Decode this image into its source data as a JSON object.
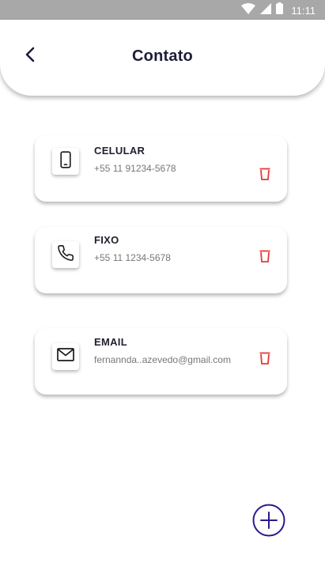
{
  "status_bar": {
    "time": "11:11",
    "icons": [
      "wifi-icon",
      "signal-icon",
      "battery-icon"
    ]
  },
  "header": {
    "title": "Contato",
    "back_icon": "chevron-left-icon"
  },
  "contacts": [
    {
      "label": "CELULAR",
      "value": "+55 11 91234-5678",
      "icon": "smartphone-icon",
      "delete_icon": "trash-icon"
    },
    {
      "label": "FIXO",
      "value": "+55 11 1234-5678",
      "icon": "phone-icon",
      "delete_icon": "trash-icon"
    },
    {
      "label": "EMAIL",
      "value": "fernannda..azevedo@gmail.com",
      "icon": "mail-icon",
      "delete_icon": "trash-icon"
    }
  ],
  "fab": {
    "icon": "plus-circle-icon"
  },
  "colors": {
    "status_bar": "#A8A8A8",
    "title": "#1D1D3A",
    "delete": "#E53935",
    "accent": "#2A1A8C"
  }
}
